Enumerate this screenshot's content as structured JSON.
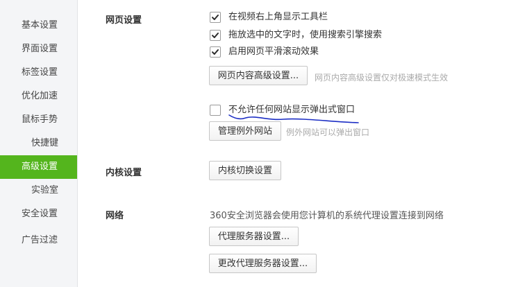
{
  "sidebar": {
    "items": [
      {
        "label": "基本设置"
      },
      {
        "label": "界面设置"
      },
      {
        "label": "标签设置"
      },
      {
        "label": "优化加速"
      },
      {
        "label": "鼠标手势"
      },
      {
        "label": "快捷键"
      },
      {
        "label": "高级设置",
        "active": true
      },
      {
        "label": "实验室"
      },
      {
        "label": "安全设置"
      },
      {
        "label": "广告过滤"
      }
    ],
    "active_color": "#54b51d"
  },
  "webpage": {
    "title": "网页设置",
    "options": [
      {
        "label": "在视频右上角显示工具栏",
        "checked": true
      },
      {
        "label": "拖放选中的文字时，使用搜索引擎搜索",
        "checked": true
      },
      {
        "label": "启用网页平滑滚动效果",
        "checked": true
      }
    ],
    "advanced_button": "网页内容高级设置...",
    "advanced_hint": "网页内容高级设置仅对极速模式生效",
    "popup_option": {
      "label": "不允许任何网站显示弹出式窗口",
      "checked": false
    },
    "exceptions_button": "管理例外网站",
    "exceptions_hint": "例外网站可以弹出窗口"
  },
  "kernel": {
    "title": "内核设置",
    "switch_button": "内核切换设置"
  },
  "network": {
    "title": "网络",
    "description": "360安全浏览器会使用您计算机的系统代理设置连接到网络",
    "proxy_button": "代理服务器设置...",
    "change_proxy_button": "更改代理服务器设置..."
  },
  "icons": {
    "checkmark": "checkmark-icon"
  }
}
